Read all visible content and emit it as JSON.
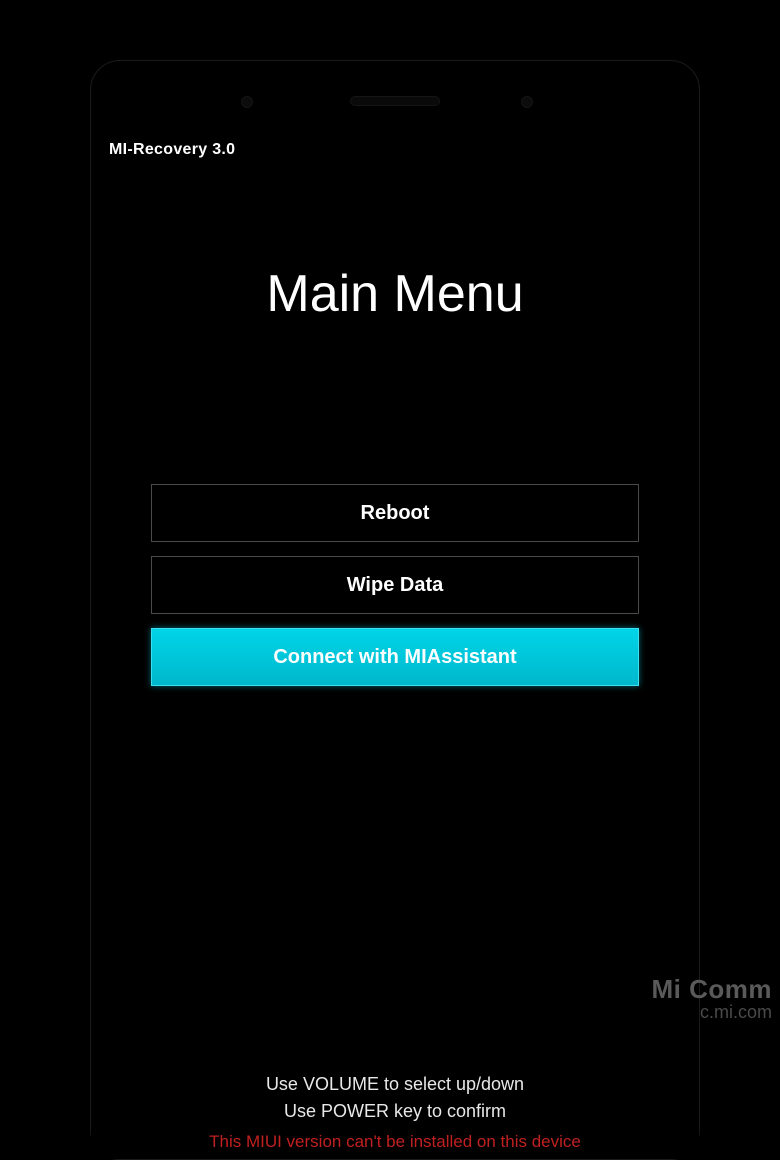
{
  "header": {
    "recovery_label": "MI-Recovery 3.0"
  },
  "title": "Main Menu",
  "menu": {
    "items": [
      {
        "label": "Reboot",
        "selected": false
      },
      {
        "label": "Wipe Data",
        "selected": false
      },
      {
        "label": "Connect with MIAssistant",
        "selected": true
      }
    ]
  },
  "instructions": {
    "line1": "Use VOLUME to select up/down",
    "line2": "Use POWER key to confirm",
    "warning": "This MIUI version can't be installed on this device"
  },
  "watermark": {
    "line1": "Mi Comm",
    "line2": "c.mi.com"
  }
}
